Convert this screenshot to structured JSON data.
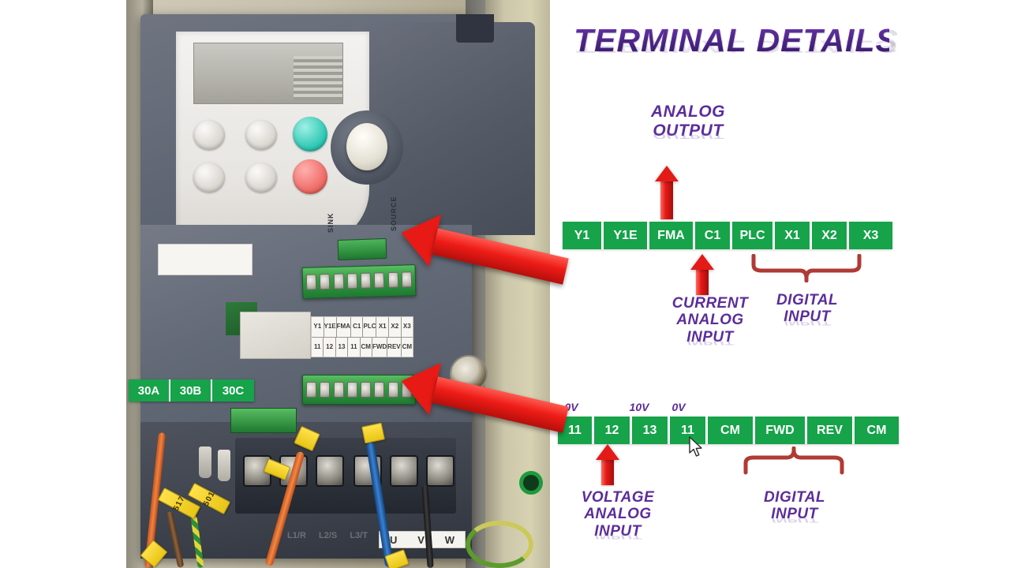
{
  "title": {
    "text": "TERMINAL DETAILS"
  },
  "photo": {
    "alt_name": "vfd-drive-terminal-photo",
    "relay_overlay": {
      "cells": [
        "30A",
        "30B",
        "30C"
      ]
    },
    "printed_label": {
      "row_top": [
        "Y1",
        "Y1E",
        "FMA",
        "C1",
        "PLC",
        "X1",
        "X2",
        "X3"
      ],
      "row_bottom": [
        "11",
        "12",
        "13",
        "11",
        "CM",
        "FWD",
        "REV",
        "CM"
      ]
    },
    "power_terminals": {
      "uvw": [
        "U",
        "V",
        "W"
      ],
      "lrs": [
        "L1/R",
        "L2/S",
        "L3/T"
      ]
    },
    "wire_tags": [
      "517",
      "501"
    ],
    "board_text": {
      "source": "SOURCE",
      "sink": "SINK"
    }
  },
  "diagram": {
    "top_row": {
      "cells": [
        "Y1",
        "Y1E",
        "FMA",
        "C1",
        "PLC",
        "X1",
        "X2",
        "X3"
      ]
    },
    "bottom_row": {
      "cells": [
        "11",
        "12",
        "13",
        "11",
        "CM",
        "FWD",
        "REV",
        "CM"
      ],
      "voltage_markers": [
        "0V",
        "10V",
        "0V"
      ]
    },
    "callouts": {
      "analog_output": "ANALOG\nOUTPUT",
      "analog_output_l1": "ANALOG",
      "analog_output_l2": "OUTPUT",
      "current_analog_input_l1": "CURRENT",
      "current_analog_input_l2": "ANALOG",
      "current_analog_input_l3": "INPUT",
      "digital_input_top_l1": "DIGITAL",
      "digital_input_top_l2": "INPUT",
      "voltage_analog_input_l1": "VOLTAGE",
      "voltage_analog_input_l2": "ANALOG",
      "voltage_analog_input_l3": "INPUT",
      "digital_input_bottom_l1": "DIGITAL",
      "digital_input_bottom_l2": "INPUT"
    }
  },
  "colors": {
    "terminal_green": "#16a34a",
    "accent_purple": "#5b2d9b",
    "arrow_red": "#e41a17",
    "brace_red": "#b03a34",
    "background": "#ffffff"
  }
}
